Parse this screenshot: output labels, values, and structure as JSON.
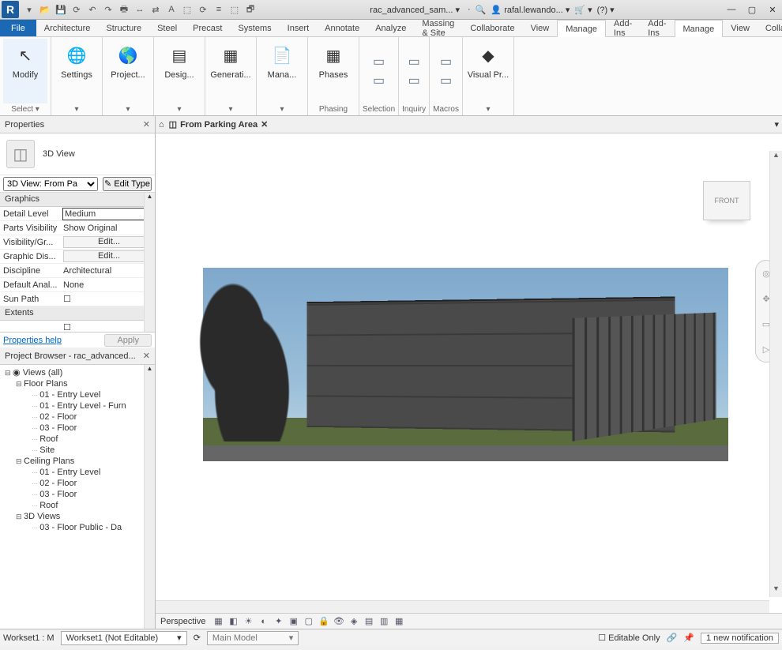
{
  "titlebar": {
    "doc": "rac_advanced_sam...",
    "user": "rafal.lewando...",
    "help": "?",
    "r": "R"
  },
  "menus": {
    "file": "File",
    "items": [
      "Architecture",
      "Structure",
      "Steel",
      "Precast",
      "Systems",
      "Insert",
      "Annotate",
      "Analyze",
      "Massing & Site",
      "Collaborate",
      "View",
      "Manage",
      "Add-Ins"
    ],
    "active": "Manage"
  },
  "ribbon": {
    "groups": [
      {
        "label": "Select ▾",
        "btns": [
          {
            "lbl": "Modify",
            "ico": "↖",
            "bg": "#eaf3fb"
          }
        ]
      },
      {
        "label": "▾",
        "btns": [
          {
            "lbl": "Settings",
            "ico": "🌐"
          }
        ]
      },
      {
        "label": "▾",
        "btns": [
          {
            "lbl": "Project...",
            "ico": "🌎"
          }
        ]
      },
      {
        "label": "▾",
        "btns": [
          {
            "lbl": "Desig...",
            "ico": "▤"
          }
        ]
      },
      {
        "label": "▾",
        "btns": [
          {
            "lbl": "Generati...",
            "ico": "▦"
          }
        ]
      },
      {
        "label": "▾",
        "btns": [
          {
            "lbl": "Mana...",
            "ico": "📄"
          }
        ]
      },
      {
        "label": "Phasing",
        "btns": [
          {
            "lbl": "Phases",
            "ico": "▦"
          }
        ]
      },
      {
        "label": "Selection",
        "btns": [
          {
            "lbl": "",
            "ico": "▭"
          },
          {
            "lbl": "",
            "ico": "▭"
          }
        ],
        "small": true
      },
      {
        "label": "Inquiry",
        "btns": [
          {
            "lbl": "",
            "ico": "▭"
          },
          {
            "lbl": "",
            "ico": "▭"
          }
        ],
        "small": true
      },
      {
        "label": "Macros",
        "btns": [
          {
            "lbl": "",
            "ico": "▭"
          },
          {
            "lbl": "",
            "ico": "▭"
          }
        ],
        "small": true
      },
      {
        "label": "▾",
        "btns": [
          {
            "lbl": "Visual Pr...",
            "ico": "◆"
          }
        ]
      }
    ]
  },
  "properties": {
    "title": "Properties",
    "typeName": "3D View",
    "selector": "3D View: From Pa",
    "editType": "Edit Type",
    "sections": [
      {
        "hdr": "Graphics",
        "rows": [
          {
            "k": "Detail Level",
            "v": "Medium",
            "sel": true
          },
          {
            "k": "Parts Visibility",
            "v": "Show Original"
          },
          {
            "k": "Visibility/Gr...",
            "v": "Edit...",
            "btn": true
          },
          {
            "k": "Graphic Dis...",
            "v": "Edit...",
            "btn": true
          },
          {
            "k": "Discipline",
            "v": "Architectural"
          },
          {
            "k": "Default Anal...",
            "v": "None"
          },
          {
            "k": "Sun Path",
            "v": "",
            "chk": true
          }
        ]
      },
      {
        "hdr": "Extents",
        "rows": [
          {
            "k": "",
            "v": "",
            "chk": true
          }
        ]
      }
    ],
    "help": "Properties help",
    "apply": "Apply"
  },
  "browser": {
    "title": "Project Browser - rac_advanced...",
    "root": "Views (all)",
    "nodes": [
      {
        "t": "Floor Plans",
        "d": 1,
        "exp": true
      },
      {
        "t": "01 - Entry Level",
        "d": 2,
        "leaf": true
      },
      {
        "t": "01 - Entry Level - Furn",
        "d": 2,
        "leaf": true
      },
      {
        "t": "02 - Floor",
        "d": 2,
        "leaf": true
      },
      {
        "t": "03 - Floor",
        "d": 2,
        "leaf": true
      },
      {
        "t": "Roof",
        "d": 2,
        "leaf": true
      },
      {
        "t": "Site",
        "d": 2,
        "leaf": true
      },
      {
        "t": "Ceiling Plans",
        "d": 1,
        "exp": true
      },
      {
        "t": "01 - Entry Level",
        "d": 2,
        "leaf": true
      },
      {
        "t": "02 - Floor",
        "d": 2,
        "leaf": true
      },
      {
        "t": "03 - Floor",
        "d": 2,
        "leaf": true
      },
      {
        "t": "Roof",
        "d": 2,
        "leaf": true
      },
      {
        "t": "3D Views",
        "d": 1,
        "exp": true
      },
      {
        "t": "03 - Floor Public - Da",
        "d": 2,
        "leaf": true
      }
    ]
  },
  "view": {
    "tab": "From Parking Area",
    "cube": "FRONT",
    "mode": "Perspective"
  },
  "status": {
    "ws1": "Workset1 : M",
    "ws2": "Workset1  (Not Editable)",
    "model": "Main Model",
    "editable": "Editable Only",
    "notif": "1 new notification"
  }
}
